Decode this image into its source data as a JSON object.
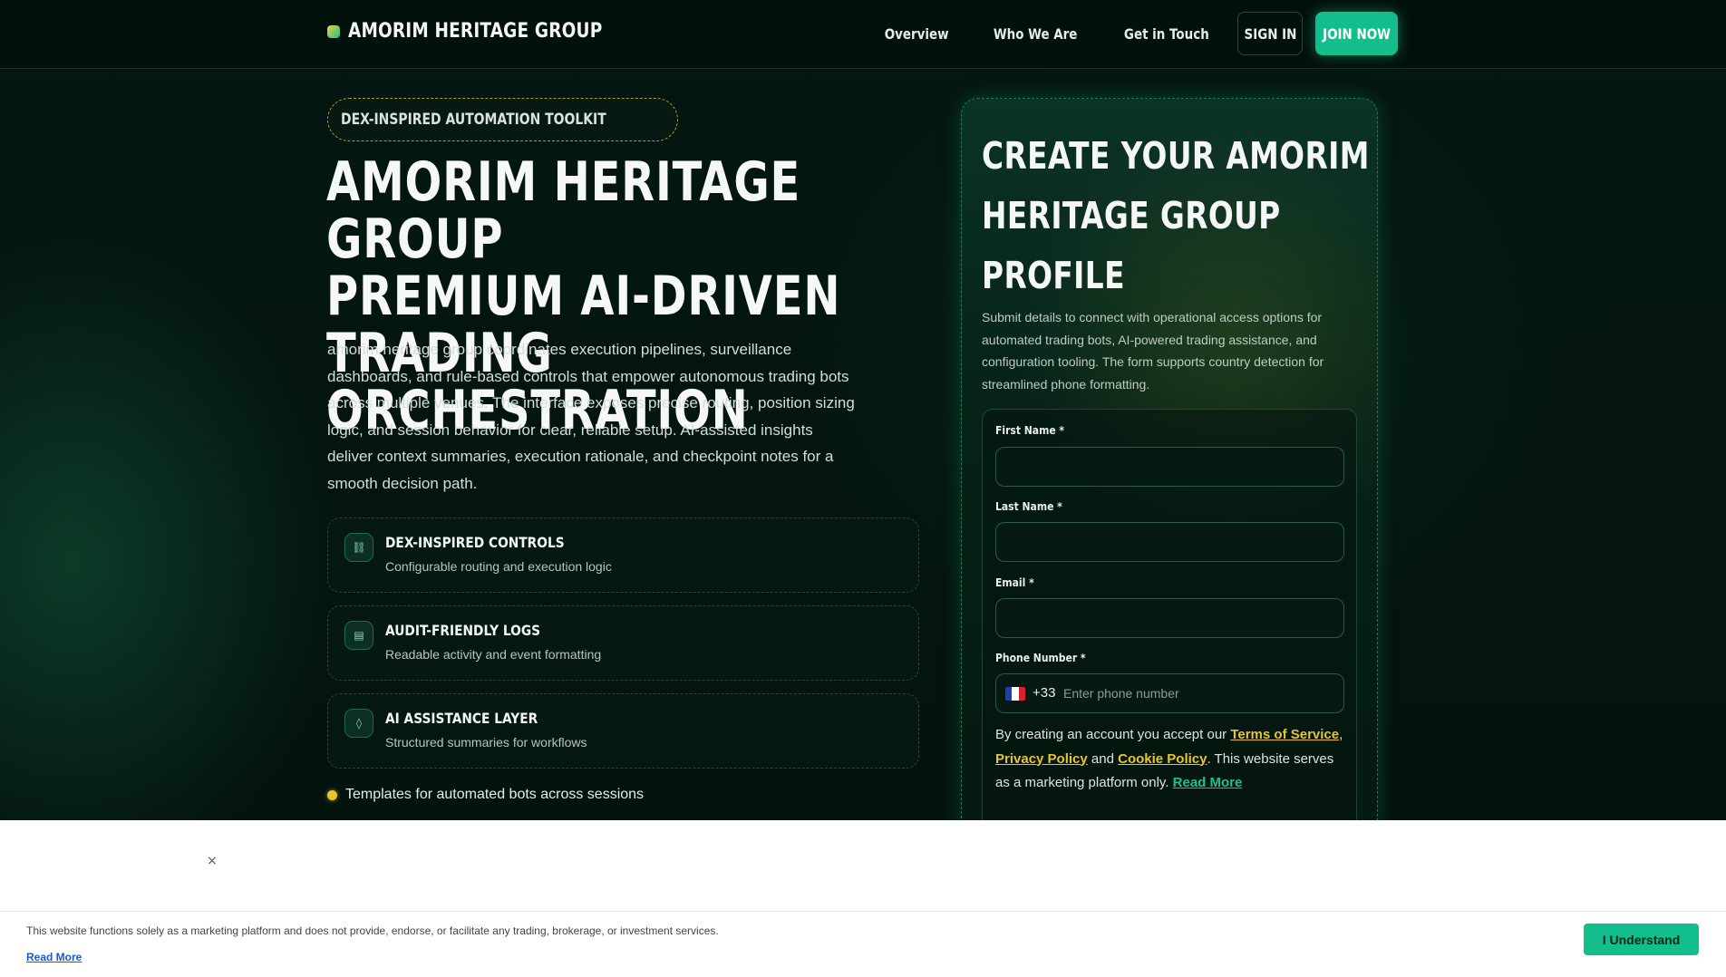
{
  "header": {
    "brand": "AMORIM HERITAGE GROUP",
    "nav": [
      "Overview",
      "Who We Are",
      "Get in Touch"
    ],
    "sign_in": "SIGN IN",
    "join_now": "JOIN NOW"
  },
  "hero": {
    "badge": "DEX-INSPIRED AUTOMATION TOOLKIT",
    "title_lines": [
      "AMORIM HERITAGE GROUP",
      "PREMIUM AI-DRIVEN",
      "TRADING ORCHESTRATION"
    ],
    "description_lines": [
      "amorim heritage group coordinates execution pipelines, surveillance",
      "dashboards, and rule-based controls that empower autonomous trading bots",
      "across multiple venues. The interface exposes precise routing, position sizing",
      "logic, and session behavior for clear, reliable setup. AI-assisted insights",
      "deliver context summaries, execution rationale, and checkpoint notes for a",
      "smooth decision path."
    ],
    "features": [
      {
        "icon": "⛓",
        "icon_name": "link-icon",
        "title": "DEX-INSPIRED CONTROLS",
        "subtitle": "Configurable routing and execution logic"
      },
      {
        "icon": "▤",
        "icon_name": "log-icon",
        "title": "AUDIT-FRIENDLY LOGS",
        "subtitle": "Readable activity and event formatting"
      },
      {
        "icon": "◊",
        "icon_name": "ai-icon",
        "title": "AI ASSISTANCE LAYER",
        "subtitle": "Structured summaries for workflows"
      }
    ],
    "bullet": "Templates for automated bots across sessions"
  },
  "form": {
    "title_lines": [
      "CREATE YOUR AMORIM",
      "HERITAGE GROUP",
      "PROFILE"
    ],
    "description_lines": [
      "Submit details to connect with operational access options for",
      "automated trading bots, AI-powered trading assistance, and",
      "configuration tooling. The form supports country detection for",
      "streamlined phone formatting."
    ],
    "first_name_label": "First Name *",
    "first_name_value": "",
    "last_name_label": "Last Name *",
    "last_name_value": "",
    "email_label": "Email *",
    "email_value": "",
    "phone_label": "Phone Number *",
    "phone_country_code": "+33",
    "phone_placeholder": "Enter phone number",
    "consent": {
      "prefix": "By creating an account you accept our ",
      "terms": "Terms of Service",
      "comma": ",",
      "privacy": "Privacy Policy",
      "and": " and ",
      "cookie": "Cookie Policy",
      "suffix": ". This website serves as a marketing platform only. ",
      "read_more": "Read More"
    }
  },
  "modal": {
    "close": "×"
  },
  "cookie_bar": {
    "text": "This website functions solely as a marketing platform and does not provide, endorse, or facilitate any trading, brokerage, or investment services.",
    "read_more": "Read More",
    "button": "I Understand"
  },
  "colors": {
    "accent_green": "#12bf8c",
    "accent_gold": "#e9c42c",
    "background": "#041410"
  }
}
